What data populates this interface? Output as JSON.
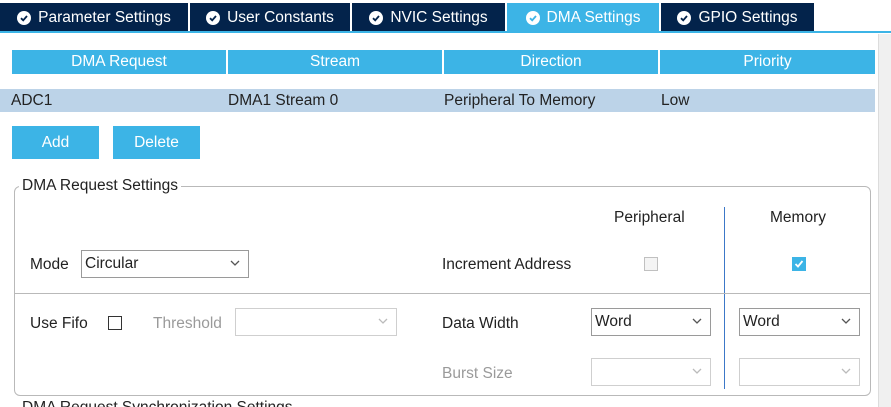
{
  "tabs": [
    {
      "label": "Parameter Settings",
      "active": false
    },
    {
      "label": "User Constants",
      "active": false
    },
    {
      "label": "NVIC Settings",
      "active": false
    },
    {
      "label": "DMA Settings",
      "active": true
    },
    {
      "label": "GPIO Settings",
      "active": false
    }
  ],
  "table": {
    "headers": [
      "DMA Request",
      "Stream",
      "Direction",
      "Priority"
    ],
    "rows": [
      [
        "ADC1",
        "DMA1 Stream 0",
        "Peripheral To Memory",
        "Low"
      ]
    ]
  },
  "buttons": {
    "add": "Add",
    "delete": "Delete"
  },
  "settings": {
    "title": "DMA Request Settings",
    "peripheral_header": "Peripheral",
    "memory_header": "Memory",
    "mode_label": "Mode",
    "mode_value": "Circular",
    "increment_label": "Increment Address",
    "increment_peripheral_checked": false,
    "increment_memory_checked": true,
    "use_fifo_label": "Use Fifo",
    "use_fifo_checked": false,
    "threshold_label": "Threshold",
    "threshold_value": "",
    "data_width_label": "Data Width",
    "data_width_peripheral": "Word",
    "data_width_memory": "Word",
    "burst_size_label": "Burst Size",
    "burst_peripheral": "",
    "burst_memory": ""
  },
  "footer_partial_text": "DMA Request Synchronization Settings",
  "colors": {
    "accent": "#3cb4e6",
    "tab_dark": "#03234b",
    "row_selected": "#bcd3e8"
  }
}
